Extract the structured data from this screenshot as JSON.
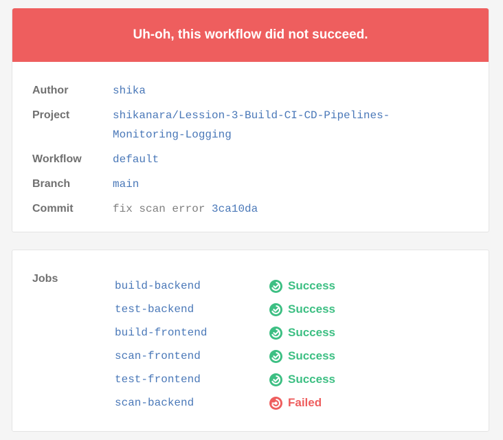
{
  "banner": {
    "title": "Uh-oh, this workflow did not succeed."
  },
  "details": {
    "author_label": "Author",
    "author": "shika",
    "project_label": "Project",
    "project_line1": "shikanara/Lession-3-Build-CI-CD-Pipelines-",
    "project_line2": "Monitoring-Logging",
    "workflow_label": "Workflow",
    "workflow": "default",
    "branch_label": "Branch",
    "branch": "main",
    "commit_label": "Commit",
    "commit_message": "fix scan error",
    "commit_hash": "3ca10da"
  },
  "jobs": {
    "label": "Jobs",
    "items": [
      {
        "name": "build-backend",
        "status": "Success",
        "state": "success"
      },
      {
        "name": "test-backend",
        "status": "Success",
        "state": "success"
      },
      {
        "name": "build-frontend",
        "status": "Success",
        "state": "success"
      },
      {
        "name": "scan-frontend",
        "status": "Success",
        "state": "success"
      },
      {
        "name": "test-frontend",
        "status": "Success",
        "state": "success"
      },
      {
        "name": "scan-backend",
        "status": "Failed",
        "state": "failed"
      }
    ]
  },
  "colors": {
    "failed": "#ee5e5e",
    "success": "#3dbf83",
    "link": "#4a78b8"
  },
  "icons": {
    "success": "success-check-icon",
    "failed": "failed-icon"
  }
}
